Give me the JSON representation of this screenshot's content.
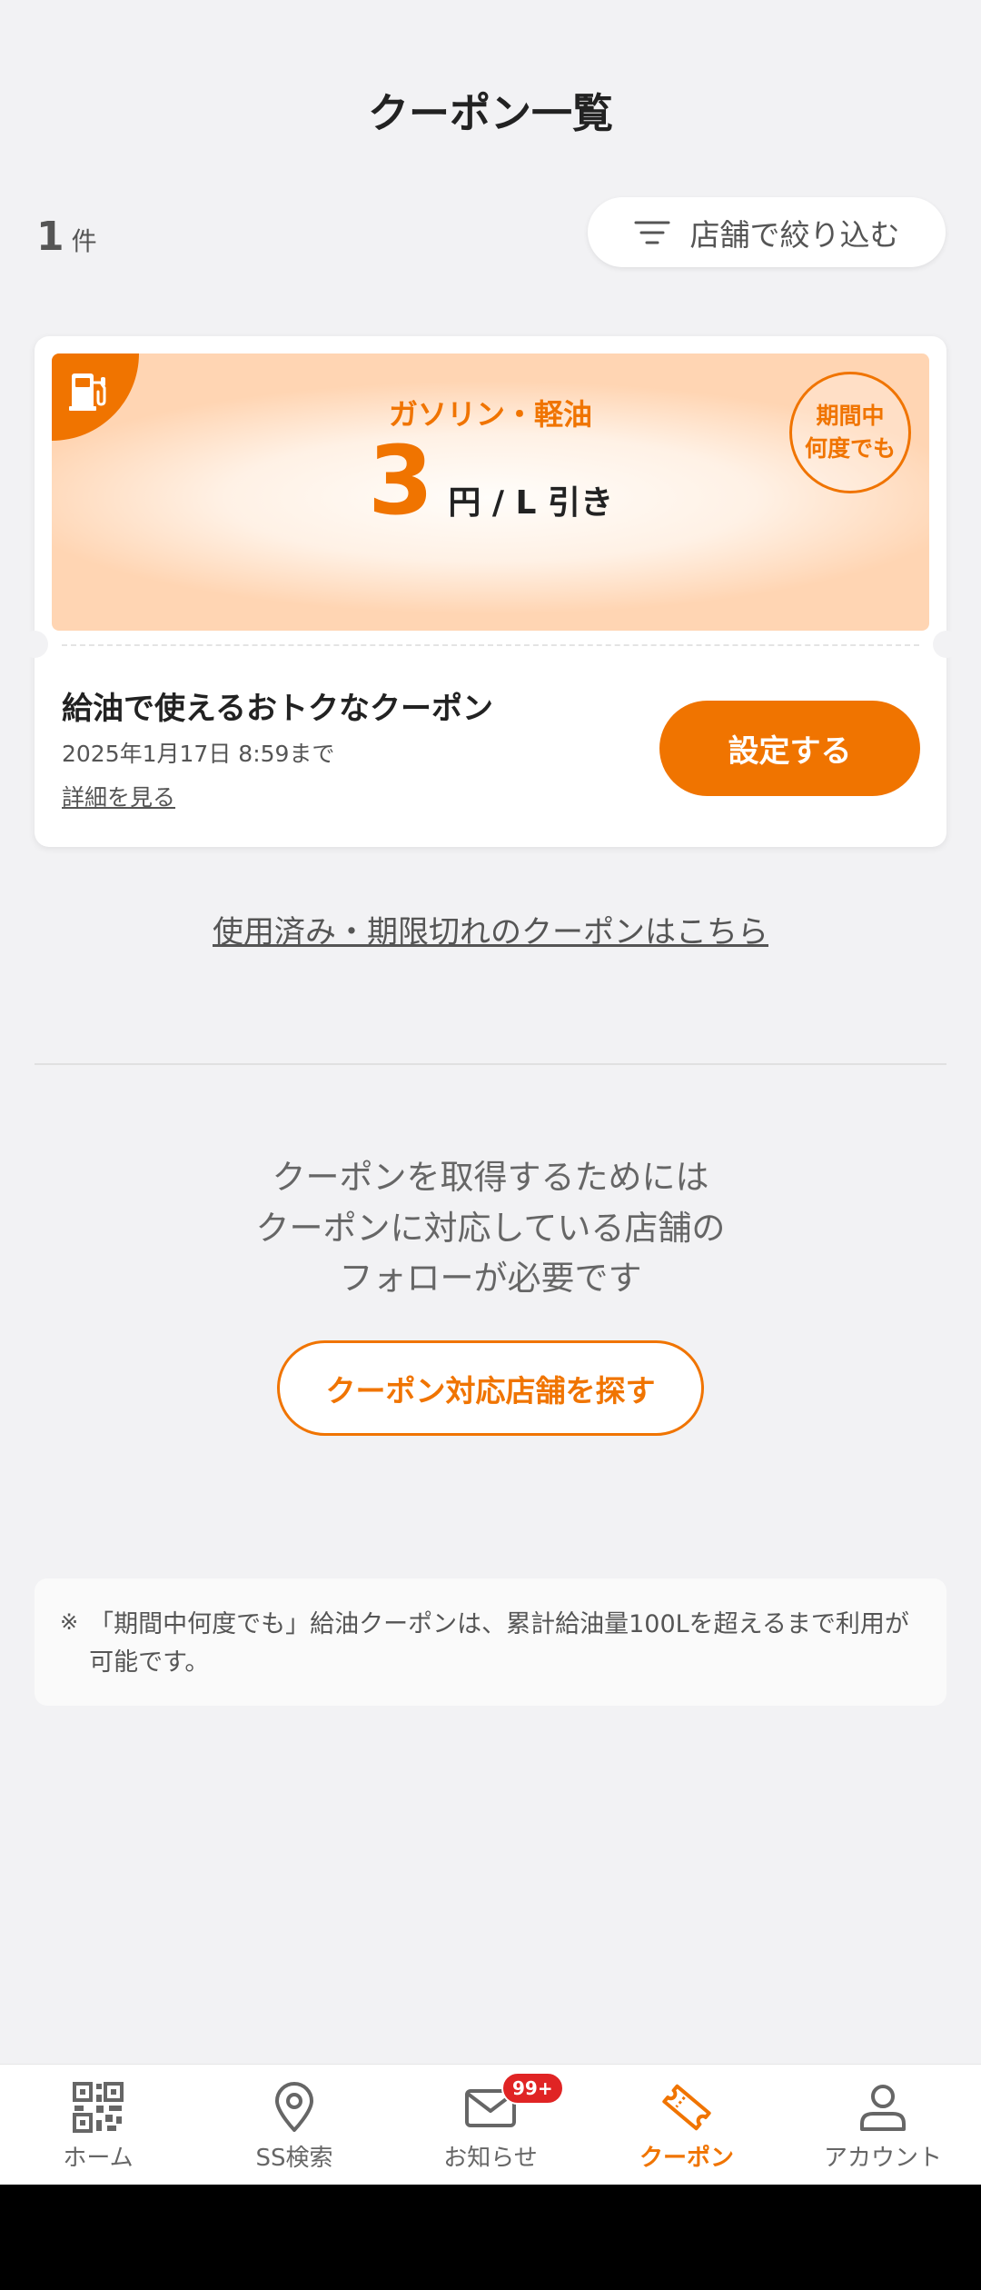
{
  "header": {
    "title": "クーポン一覧"
  },
  "summary": {
    "count": "1",
    "count_unit": "件",
    "filter_label": "店舗で絞り込む"
  },
  "coupon": {
    "fuel_type": "ガソリン・軽油",
    "discount_amount": "3",
    "discount_unit": "円 / L 引き",
    "badge": "期間中\n何度でも",
    "title": "給油で使えるおトクなクーポン",
    "expiry": "2025年1月17日 8:59まで",
    "detail_link": "詳細を見る",
    "set_button": "設定する",
    "accent_color": "#f07400"
  },
  "used_link": "使用済み・期限切れのクーポンはこちら",
  "info": {
    "line1": "クーポンを取得するためには",
    "line2": "クーポンに対応している店舗の",
    "line3": "フォローが必要です"
  },
  "find_button": "クーポン対応店舗を探す",
  "note": {
    "mark": "※",
    "text": "「期間中何度でも」給油クーポンは、累計給油量100Lを超えるまで利用が可能です。"
  },
  "tabbar": {
    "items": [
      {
        "label": "ホーム",
        "icon": "qr-code-icon"
      },
      {
        "label": "SS検索",
        "icon": "location-pin-icon"
      },
      {
        "label": "お知らせ",
        "icon": "mail-icon",
        "badge": "99+"
      },
      {
        "label": "クーポン",
        "icon": "ticket-icon",
        "active": true
      },
      {
        "label": "アカウント",
        "icon": "person-icon"
      }
    ]
  }
}
